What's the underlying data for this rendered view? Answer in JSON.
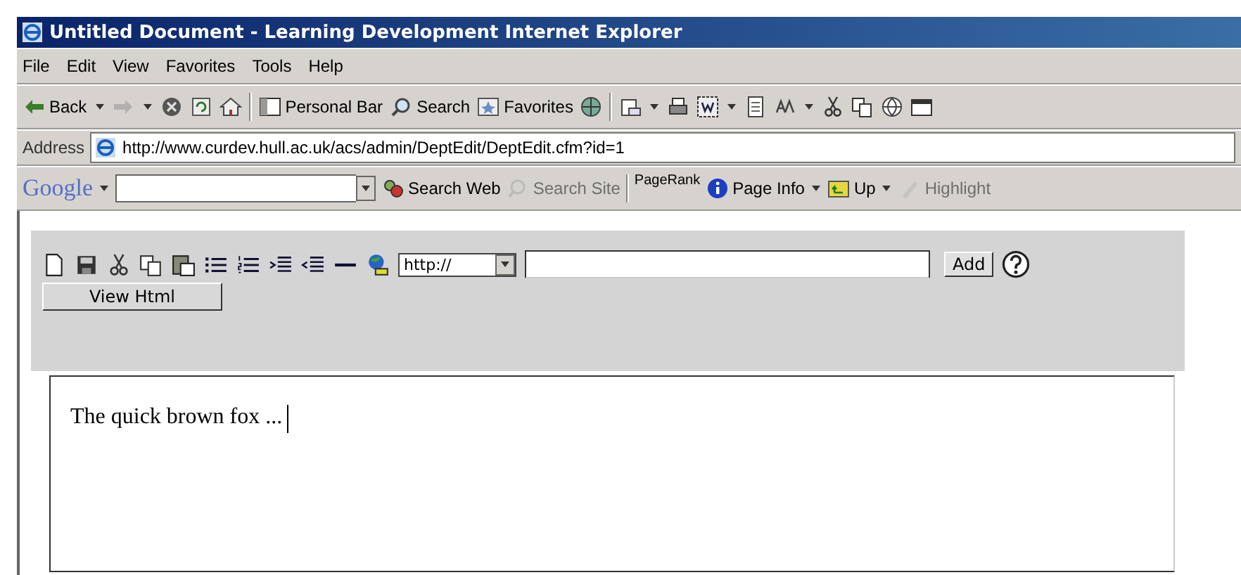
{
  "window": {
    "title": "Untitled Document - Learning Development Internet Explorer"
  },
  "menu": [
    "File",
    "Edit",
    "View",
    "Favorites",
    "Tools",
    "Help"
  ],
  "toolbar": {
    "back": "Back",
    "personal_bar": "Personal Bar",
    "search": "Search",
    "favorites": "Favorites"
  },
  "address": {
    "label": "Address",
    "value": "http://www.curdev.hull.ac.uk/acs/admin/DeptEdit/DeptEdit.cfm?id=1"
  },
  "google_bar": {
    "logo": "Google",
    "items": [
      {
        "label": "Search Web",
        "disabled": false
      },
      {
        "label": "Search Site",
        "disabled": true
      },
      {
        "label": "PageRank",
        "disabled": false
      },
      {
        "label": "Page Info",
        "disabled": false
      },
      {
        "label": "Up",
        "disabled": false
      },
      {
        "label": "Highlight",
        "disabled": true
      }
    ]
  },
  "editor": {
    "protocol": "http://",
    "add_button": "Add",
    "view_html_button": "View Html",
    "content": "The quick brown fox ..."
  }
}
